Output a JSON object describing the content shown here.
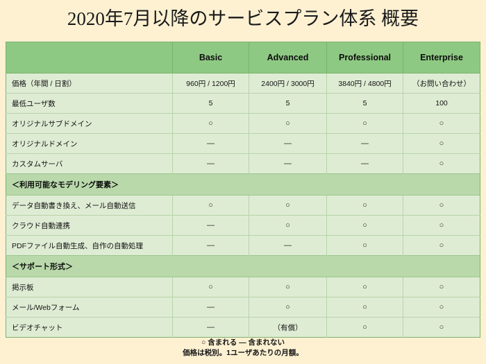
{
  "title": "2020年7月以降のサービスプラン体系 概要",
  "colors": {
    "page_background": "#fdf1d2",
    "header_green": "#8ec983",
    "section_green": "#b9d9ab",
    "row_green": "#dfecd4",
    "border_green": "#b7d4a9",
    "text": "#111111"
  },
  "table": {
    "columns": [
      {
        "key": "feature",
        "label": ""
      },
      {
        "key": "basic",
        "label": "Basic"
      },
      {
        "key": "advanced",
        "label": "Advanced"
      },
      {
        "key": "professional",
        "label": "Professional"
      },
      {
        "key": "enterprise",
        "label": "Enterprise"
      }
    ],
    "rows": [
      {
        "type": "data",
        "feature": "価格（年間 / 日割）",
        "basic": "960円 / 1200円",
        "advanced": "2400円 / 3000円",
        "professional": "3840円 / 4800円",
        "enterprise": "（お問い合わせ）"
      },
      {
        "type": "data",
        "feature": "最低ユーザ数",
        "basic": "5",
        "advanced": "5",
        "professional": "5",
        "enterprise": "100"
      },
      {
        "type": "data",
        "feature": "オリジナルサブドメイン",
        "basic": "○",
        "advanced": "○",
        "professional": "○",
        "enterprise": "○"
      },
      {
        "type": "data",
        "feature": "オリジナルドメイン",
        "basic": "―",
        "advanced": "―",
        "professional": "―",
        "enterprise": "○"
      },
      {
        "type": "data",
        "feature": "カスタムサーバ",
        "basic": "―",
        "advanced": "―",
        "professional": "―",
        "enterprise": "○"
      },
      {
        "type": "section",
        "feature": "＜利用可能なモデリング要素＞"
      },
      {
        "type": "data",
        "feature": "データ自動書き換え、メール自動送信",
        "basic": "○",
        "advanced": "○",
        "professional": "○",
        "enterprise": "○"
      },
      {
        "type": "data",
        "feature": "クラウド自動連携",
        "basic": "―",
        "advanced": "○",
        "professional": "○",
        "enterprise": "○"
      },
      {
        "type": "data",
        "feature": "PDFファイル自動生成、自作の自動処理",
        "basic": "―",
        "advanced": "―",
        "professional": "○",
        "enterprise": "○"
      },
      {
        "type": "section",
        "feature": "＜サポート形式＞"
      },
      {
        "type": "data",
        "feature": "掲示板",
        "basic": "○",
        "advanced": "○",
        "professional": "○",
        "enterprise": "○"
      },
      {
        "type": "data",
        "feature": "メール/Webフォーム",
        "basic": "―",
        "advanced": "○",
        "professional": "○",
        "enterprise": "○"
      },
      {
        "type": "data",
        "feature": "ビデオチャット",
        "basic": "―",
        "advanced": "（有償）",
        "professional": "○",
        "enterprise": "○"
      }
    ]
  },
  "footnotes": [
    "○ 含まれる  ― 含まれない",
    "価格は税別。1ユーザあたりの月額。"
  ]
}
